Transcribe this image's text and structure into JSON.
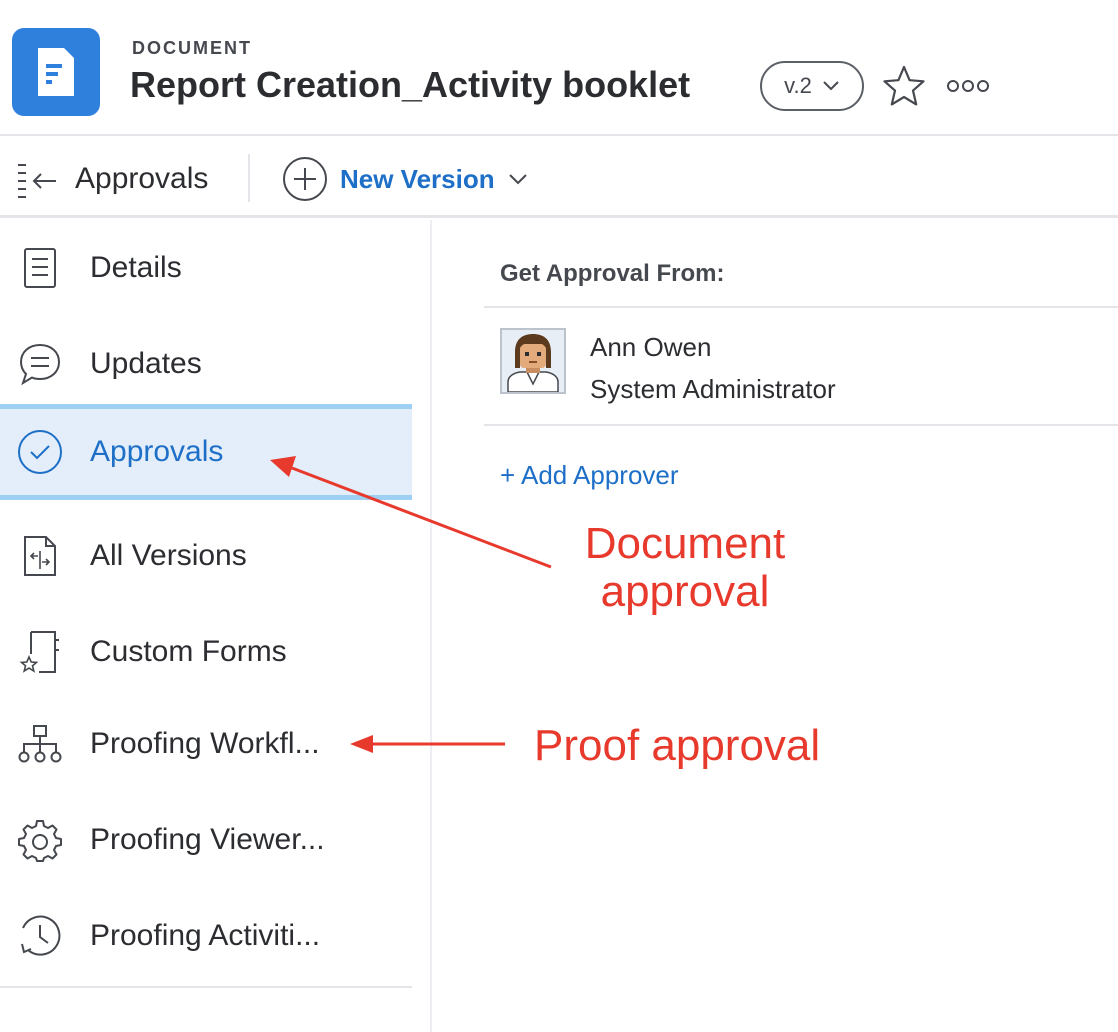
{
  "header": {
    "doc_type": "DOCUMENT",
    "title": "Report Creation_Activity booklet",
    "version": "v.2",
    "icons": {
      "doc": "document-icon",
      "star": "star-icon",
      "more": "more-options-icon"
    },
    "colors": {
      "doc_tile": "#2f7fdd"
    }
  },
  "toolbar": {
    "section_title": "Approvals",
    "new_version_label": "New Version",
    "icons": {
      "collapse": "collapse-panel-icon",
      "add": "plus-circle-icon",
      "chevron": "chevron-down-icon"
    }
  },
  "sidebar": {
    "active_index": 2,
    "items": [
      {
        "label": "Details",
        "icon": "details-icon"
      },
      {
        "label": "Updates",
        "icon": "chat-bubble-icon"
      },
      {
        "label": "Approvals",
        "icon": "check-circle-icon"
      },
      {
        "label": "All Versions",
        "icon": "versions-icon"
      },
      {
        "label": "Custom Forms",
        "icon": "custom-form-icon"
      },
      {
        "label": "Proofing Workfl...",
        "icon": "workflow-icon"
      },
      {
        "label": "Proofing Viewer...",
        "icon": "gear-icon"
      },
      {
        "label": "Proofing Activiti...",
        "icon": "history-icon"
      }
    ]
  },
  "main": {
    "heading": "Get Approval From:",
    "approvers": [
      {
        "name": "Ann Owen",
        "role": "System Administrator"
      }
    ],
    "add_label": "+ Add Approver"
  },
  "annotations": {
    "document_approval": "Document approval",
    "proof_approval": "Proof approval",
    "color": "#e8392d"
  }
}
